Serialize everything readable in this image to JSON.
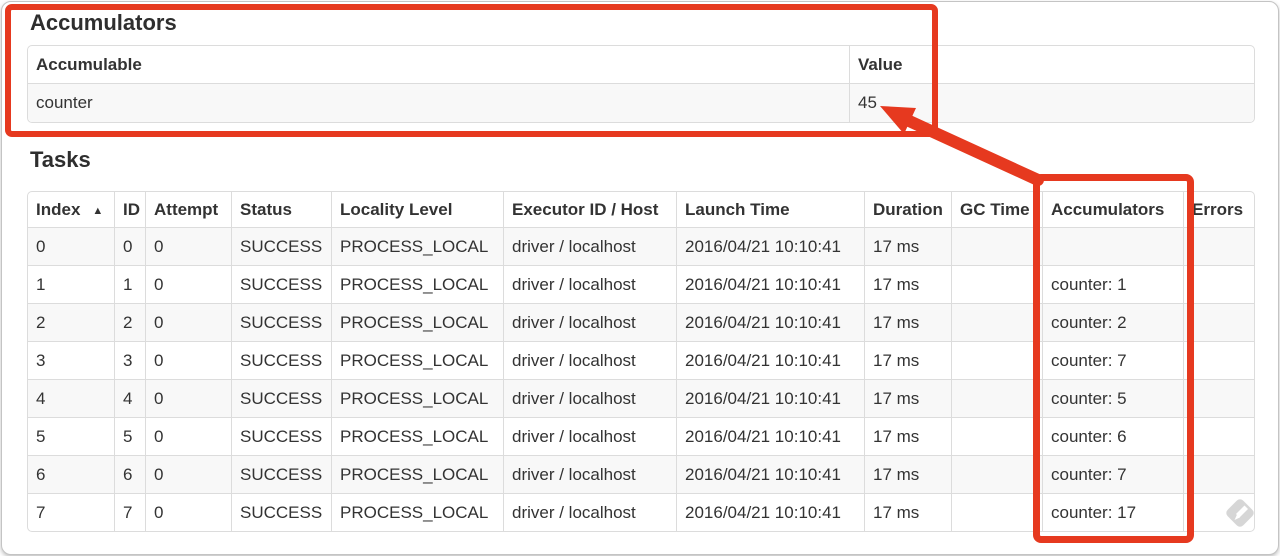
{
  "accumulators_section": {
    "title": "Accumulators",
    "table": {
      "columns": [
        "Accumulable",
        "Value"
      ],
      "rows": [
        [
          "counter",
          "45"
        ]
      ]
    }
  },
  "tasks_section": {
    "title": "Tasks",
    "table": {
      "sort_indicator": "▲",
      "columns": [
        "Index",
        "ID",
        "Attempt",
        "Status",
        "Locality Level",
        "Executor ID / Host",
        "Launch Time",
        "Duration",
        "GC Time",
        "Accumulators",
        "Errors"
      ],
      "rows": [
        [
          "0",
          "0",
          "0",
          "SUCCESS",
          "PROCESS_LOCAL",
          "driver / localhost",
          "2016/04/21 10:10:41",
          "17 ms",
          "",
          "",
          ""
        ],
        [
          "1",
          "1",
          "0",
          "SUCCESS",
          "PROCESS_LOCAL",
          "driver / localhost",
          "2016/04/21 10:10:41",
          "17 ms",
          "",
          "counter: 1",
          ""
        ],
        [
          "2",
          "2",
          "0",
          "SUCCESS",
          "PROCESS_LOCAL",
          "driver / localhost",
          "2016/04/21 10:10:41",
          "17 ms",
          "",
          "counter: 2",
          ""
        ],
        [
          "3",
          "3",
          "0",
          "SUCCESS",
          "PROCESS_LOCAL",
          "driver / localhost",
          "2016/04/21 10:10:41",
          "17 ms",
          "",
          "counter: 7",
          ""
        ],
        [
          "4",
          "4",
          "0",
          "SUCCESS",
          "PROCESS_LOCAL",
          "driver / localhost",
          "2016/04/21 10:10:41",
          "17 ms",
          "",
          "counter: 5",
          ""
        ],
        [
          "5",
          "5",
          "0",
          "SUCCESS",
          "PROCESS_LOCAL",
          "driver / localhost",
          "2016/04/21 10:10:41",
          "17 ms",
          "",
          "counter: 6",
          ""
        ],
        [
          "6",
          "6",
          "0",
          "SUCCESS",
          "PROCESS_LOCAL",
          "driver / localhost",
          "2016/04/21 10:10:41",
          "17 ms",
          "",
          "counter: 7",
          ""
        ],
        [
          "7",
          "7",
          "0",
          "SUCCESS",
          "PROCESS_LOCAL",
          "driver / localhost",
          "2016/04/21 10:10:41",
          "17 ms",
          "",
          "counter: 17",
          ""
        ]
      ]
    }
  },
  "annotations": {
    "highlight_color": "#e6391f"
  },
  "theme": {
    "stripe_color": "#f8f8f8",
    "table_border_color": "#dcdcdc",
    "watermark_color": "#d6d6d6"
  }
}
